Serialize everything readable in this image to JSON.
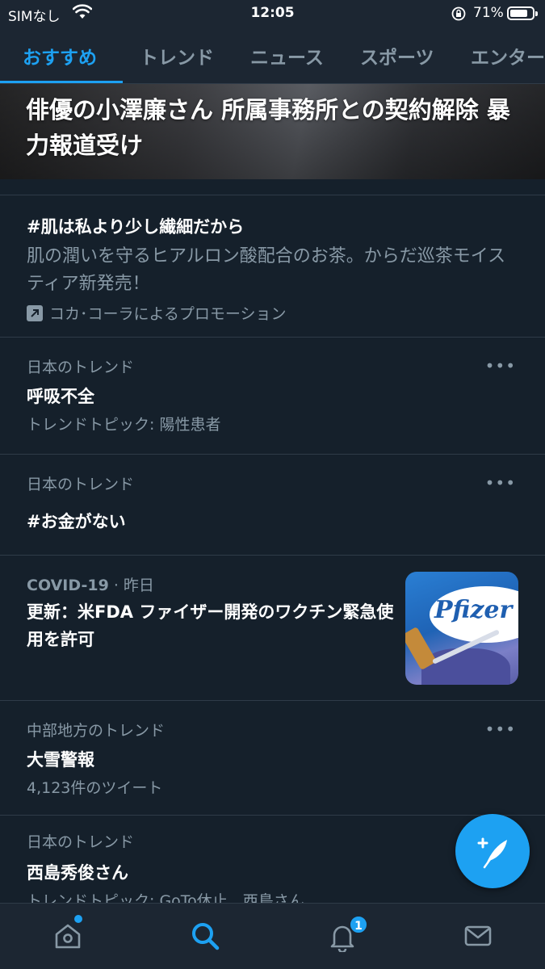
{
  "status_bar": {
    "carrier": "SIMなし",
    "time": "12:05",
    "battery": "71%",
    "battery_level": 0.71
  },
  "tabs": [
    {
      "label": "おすすめ",
      "active": true
    },
    {
      "label": "トレンド"
    },
    {
      "label": "ニュース"
    },
    {
      "label": "スポーツ"
    },
    {
      "label": "エンター"
    }
  ],
  "hero": {
    "title": "俳優の小澤廉さん 所属事務所との契約解除 暴力報道受け"
  },
  "promoted": {
    "title": "#肌は私より少し繊細だから",
    "description": "肌の潤いを守るヒアルロン酸配合のお茶。からだ巡茶モイスティア新発売！",
    "promoted_by": "コカ･コーラによるプロモーション"
  },
  "trends": [
    {
      "context": "日本のトレンド",
      "title": "呼吸不全",
      "subtitle": "トレンドトピック: 陽性患者"
    },
    {
      "context": "日本のトレンド",
      "title": "#お金がない",
      "subtitle": ""
    },
    {
      "context": "中部地方のトレンド",
      "title": "大雪警報",
      "subtitle": "4,123件のツイート"
    },
    {
      "context": "日本のトレンド",
      "title": "西島秀俊さん",
      "subtitle": "トレンドトピック: GoTo休止、西島さん"
    }
  ],
  "news": {
    "category": "COVID-19",
    "time": " · 昨日",
    "title": "更新：米FDA ファイザー開発のワクチン緊急使用を許可",
    "thumb_text": "Pfizer"
  },
  "more_label": "•••",
  "bottom_nav": {
    "notifications_badge": "1"
  },
  "colors": {
    "background": "#15202b",
    "accent": "#1da1f2",
    "secondary_text": "#8899a6",
    "divider": "#2f3b48"
  }
}
